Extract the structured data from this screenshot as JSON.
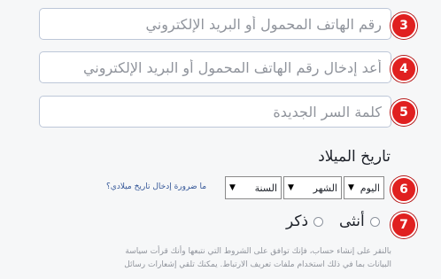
{
  "fields": {
    "mobile_email": {
      "placeholder": "رقم الهاتف المحمول أو البريد الإلكتروني",
      "step": "3"
    },
    "reenter_mobile_email": {
      "placeholder": "أعد إدخال رقم الهاتف المحمول أو البريد الإلكتروني",
      "step": "4"
    },
    "new_password": {
      "placeholder": "كلمة السر الجديدة",
      "step": "5"
    }
  },
  "birthday": {
    "heading": "تاريخ الميلاد",
    "step": "6",
    "day_label": "اليوم",
    "month_label": "الشهر",
    "year_label": "السنة",
    "hint_link": "ما ضرورة إدخال تاريخ ميلادي؟"
  },
  "gender": {
    "step": "7",
    "female_label": "أنثى",
    "male_label": "ذكر"
  },
  "terms": {
    "line1": "بالنقر على إنشاء حساب، فإنك توافق على الشروط التي نتبعها وأنك قرأت سياسة",
    "line2": "البيانات بما في ذلك استخدام ملفات تعريف الارتباط. يمكنك تلقي إشعارات رسائل"
  },
  "colors": {
    "badge": "#e02020",
    "link": "#365899",
    "field_border": "#bdc7d8"
  }
}
